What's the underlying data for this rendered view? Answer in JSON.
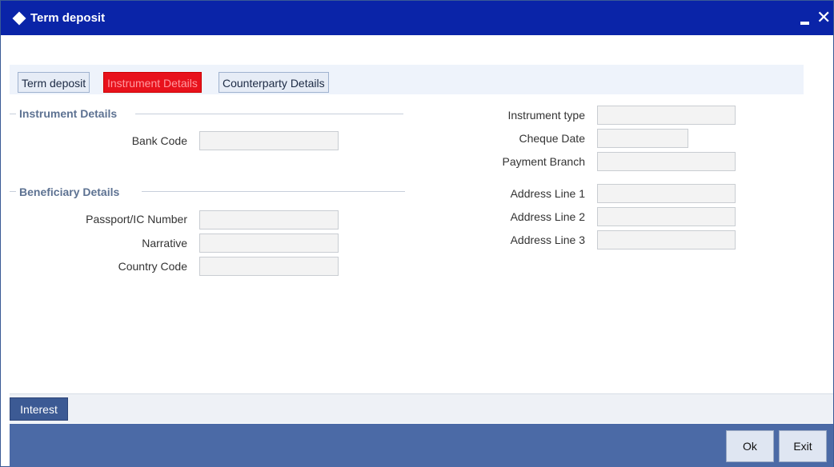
{
  "window": {
    "title": "Term deposit"
  },
  "tabs": [
    {
      "label": "Term deposit",
      "active": false
    },
    {
      "label": "Instrument Details",
      "active": true
    },
    {
      "label": "Counterparty Details",
      "active": false
    }
  ],
  "colors": {
    "title_bar": "#0a24a8",
    "active_tab": "#e8121c",
    "footer": "#4b6aa6",
    "section_title": "#5d7292"
  },
  "sections": {
    "instrument_details": "Instrument Details",
    "beneficiary_details": "Beneficiary Details"
  },
  "left_fields": {
    "bank_code": {
      "label": "Bank Code",
      "value": ""
    },
    "passport": {
      "label": "Passport/IC Number",
      "value": ""
    },
    "narrative": {
      "label": "Narrative",
      "value": ""
    },
    "country_code": {
      "label": "Country Code",
      "value": ""
    }
  },
  "right_fields": {
    "instrument_type": {
      "label": "Instrument type",
      "value": ""
    },
    "cheque_date": {
      "label": "Cheque Date",
      "value": ""
    },
    "payment_branch": {
      "label": "Payment Branch",
      "value": ""
    },
    "address1": {
      "label": "Address Line 1",
      "value": ""
    },
    "address2": {
      "label": "Address Line 2",
      "value": ""
    },
    "address3": {
      "label": "Address Line 3",
      "value": ""
    }
  },
  "buttons": {
    "interest": "Interest",
    "ok": "Ok",
    "exit": "Exit"
  }
}
